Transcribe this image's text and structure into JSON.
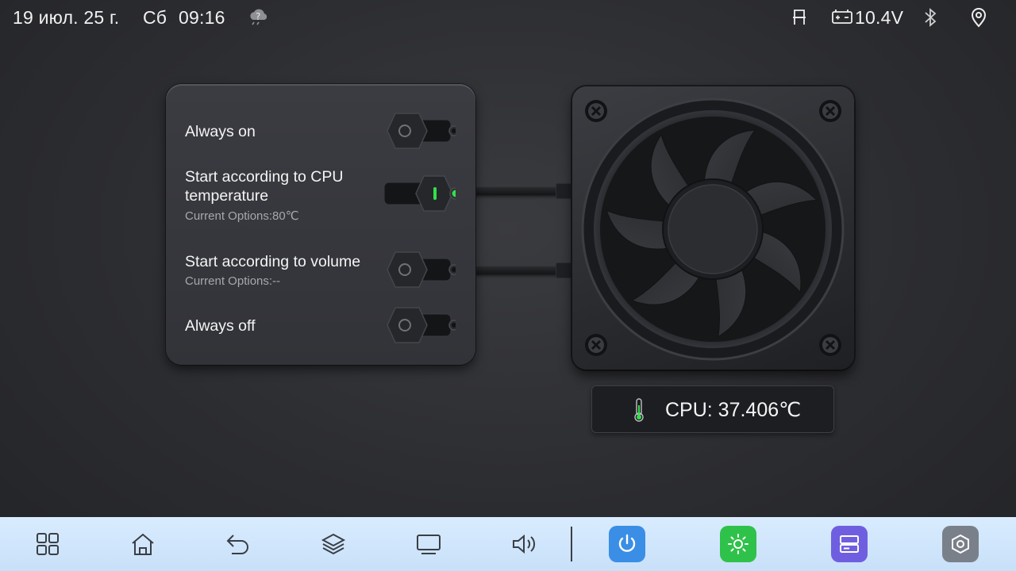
{
  "status_bar": {
    "date": "19 июл. 25 г.",
    "weekday": "Сб",
    "time": "09:16",
    "weather_icon": "cloud-rain-icon",
    "voltage": "10.4V",
    "icons": [
      "seat-icon",
      "battery-icon",
      "bluetooth-icon",
      "location-icon"
    ]
  },
  "options": [
    {
      "title": "Always on",
      "subtitle": "",
      "selected": false
    },
    {
      "title": "Start according to CPU temperature",
      "subtitle": "Current Options:80℃",
      "selected": true
    },
    {
      "title": "Start according to volume",
      "subtitle": "Current Options:--",
      "selected": false
    },
    {
      "title": "Always off",
      "subtitle": "",
      "selected": false
    }
  ],
  "cpu": {
    "label": "CPU: 37.406℃",
    "icon": "thermometer-icon"
  },
  "dock": {
    "items": [
      "apps-grid-icon",
      "home-icon",
      "back-icon",
      "layers-icon",
      "screen-icon",
      "volume-icon"
    ],
    "tiles": [
      {
        "icon": "power-icon",
        "color": "#3a8ee6"
      },
      {
        "icon": "brightness-icon",
        "color": "#2fc24a"
      },
      {
        "icon": "storage-icon",
        "color": "#6f5fe0"
      },
      {
        "icon": "settings-icon",
        "color": "#7a808a"
      }
    ]
  },
  "colors": {
    "accent_on": "#33e04a",
    "background": "#2c2d31",
    "dock": "#d3e7fc"
  }
}
